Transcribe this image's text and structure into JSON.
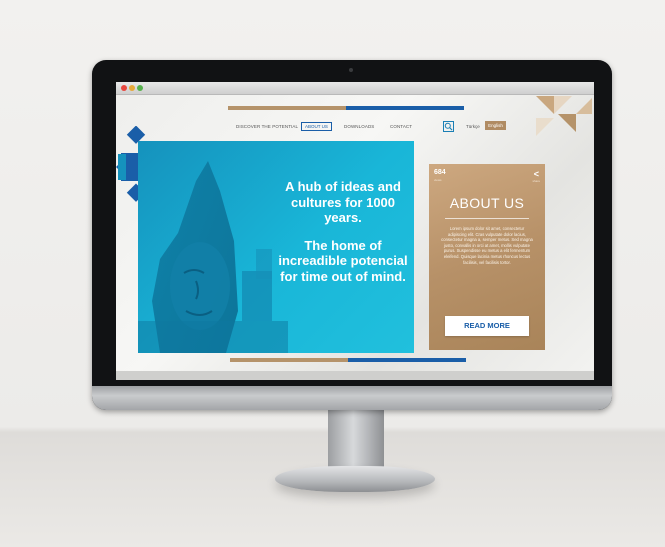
{
  "browser": {
    "controls": [
      "close",
      "minimize",
      "maximize"
    ]
  },
  "nav": {
    "items": [
      "DISCOVER THE POTENTIAL",
      "ABOUT US",
      "DOWNLOADS",
      "CONTACT"
    ],
    "active_index": 1,
    "search_icon": "search-icon",
    "languages": [
      "Türkçe",
      "English"
    ],
    "active_language": "English"
  },
  "hero": {
    "headline": "A hub of ideas and cultures for 1000 years.",
    "subline": "The home of increadible potencial for time out of mind."
  },
  "about": {
    "count": "684",
    "count_label": "views",
    "share_label": "share",
    "share_icon": "share-icon",
    "title": "ABOUT US",
    "body": "Lorem ipsum dolor sit amet, consectetur adipiscing elit. Cras vulputate dolor lacius, consectetur magna a, semper metus. Sed magna justo, convallis in orci at amet, mollis vulputate purus. Suspendisse eu metus a elit fermentum eleifend. Quisque lacinia metus rhoncus lectus facilisis, vel facilisis tortor.",
    "button": "READ MORE"
  },
  "colors": {
    "brand_blue": "#1a5ea8",
    "hero_cyan": "#19b6d8",
    "tan": "#b5936a"
  }
}
